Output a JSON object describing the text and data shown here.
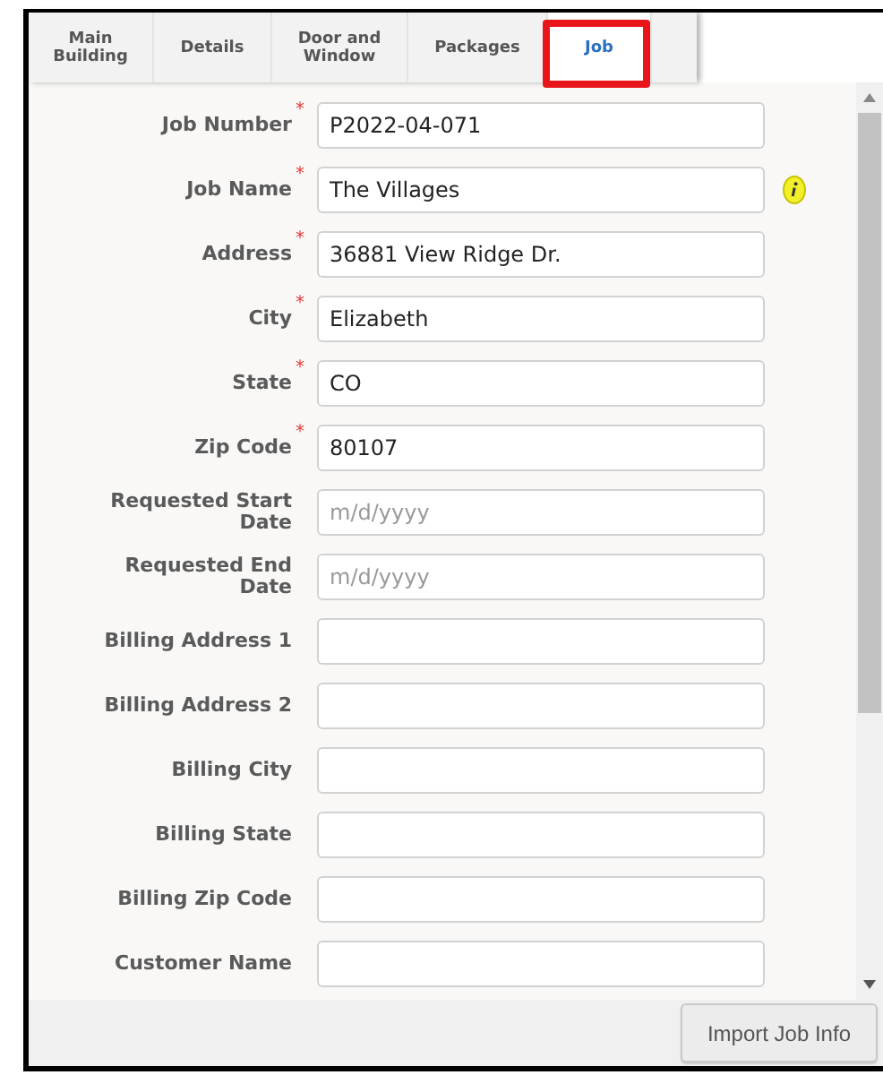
{
  "tabs": [
    {
      "label": "Main\nBuilding",
      "selected": false,
      "highlighted": false
    },
    {
      "label": "Details",
      "selected": false,
      "highlighted": false
    },
    {
      "label": "Door and\nWindow",
      "selected": false,
      "highlighted": false
    },
    {
      "label": "Packages",
      "selected": false,
      "highlighted": false
    },
    {
      "label": "Job",
      "selected": true,
      "highlighted": true
    }
  ],
  "fields": [
    {
      "label": "Job Number",
      "required_mark": "*",
      "value": "P2022-04-071"
    },
    {
      "label": "Job Name",
      "required_mark": "*",
      "value": "The Villages",
      "info": true
    },
    {
      "label": "Address",
      "required_mark": "*",
      "value": "36881 View Ridge Dr."
    },
    {
      "label": "City",
      "required_mark": "*",
      "value": "Elizabeth"
    },
    {
      "label": "State",
      "required_mark": "*",
      "value": "CO"
    },
    {
      "label": "Zip Code",
      "required_mark": "*",
      "value": "80107"
    },
    {
      "label": "Requested Start Date",
      "placeholder": "m/d/yyyy"
    },
    {
      "label": "Requested End Date",
      "placeholder": "m/d/yyyy"
    },
    {
      "label": "Billing Address 1"
    },
    {
      "label": "Billing Address 2"
    },
    {
      "label": "Billing City"
    },
    {
      "label": "Billing State"
    },
    {
      "label": "Billing Zip Code"
    },
    {
      "label": "Customer Name"
    }
  ],
  "buttons": [
    {
      "label": "Import Job Info"
    }
  ]
}
